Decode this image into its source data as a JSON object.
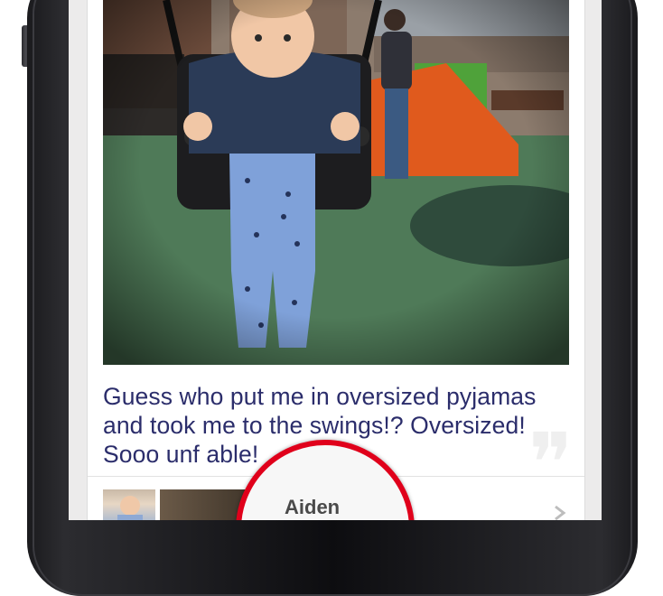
{
  "post": {
    "caption_lines": [
      "Guess who put me in oversized pyjamas",
      "and took me to the swings!? Oversized!",
      "Sooo unf        able!"
    ],
    "author_name": "Aiden"
  },
  "colors": {
    "caption_text": "#2b2d6b",
    "magnifier_ring": "#e0001b"
  },
  "icons": [
    "quote-icon",
    "chevron-right-icon"
  ]
}
